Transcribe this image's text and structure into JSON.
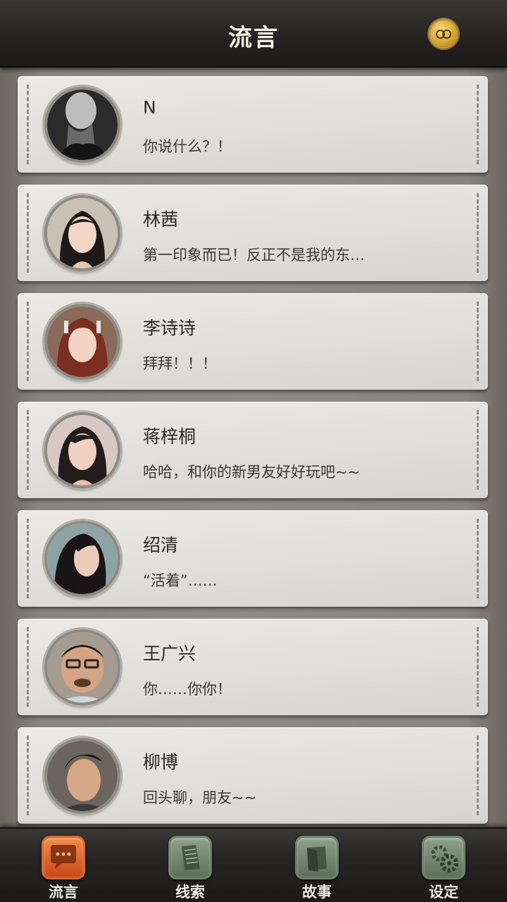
{
  "header": {
    "title": "流言",
    "coin_icon": "infinity-coin-icon"
  },
  "contacts": [
    {
      "name": "N",
      "message": "你说什么？！"
    },
    {
      "name": "林茜",
      "message": "第一印象而已！反正不是我的东…"
    },
    {
      "name": "李诗诗",
      "message": "拜拜！！！"
    },
    {
      "name": "蒋梓桐",
      "message": "哈哈，和你的新男友好好玩吧~~"
    },
    {
      "name": "绍清",
      "message": "“活着”……"
    },
    {
      "name": "王广兴",
      "message": "你……你你！"
    },
    {
      "name": "柳博",
      "message": "回头聊，朋友~~"
    }
  ],
  "tabs": [
    {
      "label": "流言",
      "icon": "chat-bubble-icon",
      "active": true
    },
    {
      "label": "线索",
      "icon": "papers-icon",
      "active": false
    },
    {
      "label": "故事",
      "icon": "book-icon",
      "active": false
    },
    {
      "label": "设定",
      "icon": "gear-icon",
      "active": false
    }
  ],
  "colors": {
    "active_tab": "#e2612a",
    "inactive_tab": "#7e917b",
    "header_bg": "#232221"
  }
}
